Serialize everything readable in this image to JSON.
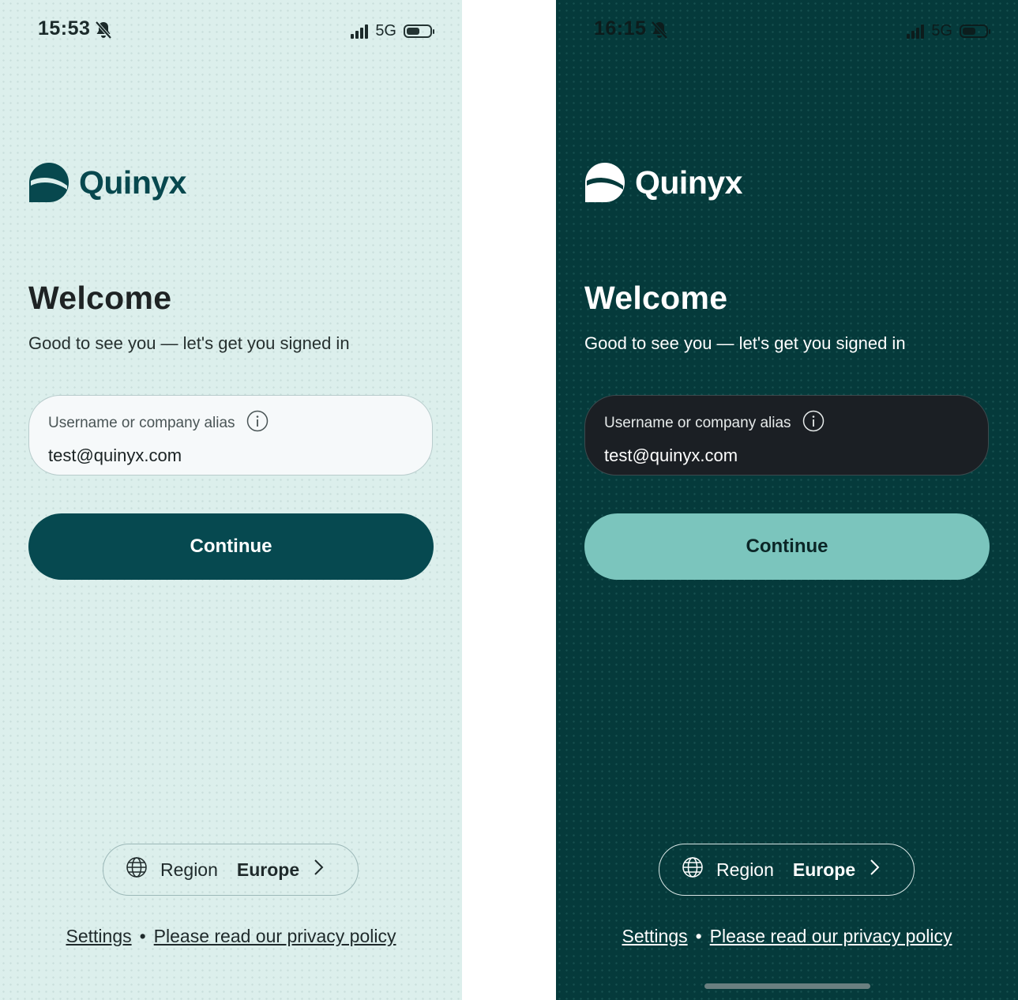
{
  "screens": [
    {
      "theme": "light",
      "status_bar": {
        "time": "15:53",
        "network": "5G"
      },
      "logo_text": "Quinyx",
      "welcome_title": "Welcome",
      "welcome_subtitle": "Good to see you — let's get you signed in",
      "field": {
        "label": "Username or company alias",
        "value": "test@quinyx.com"
      },
      "continue_label": "Continue",
      "region": {
        "label": "Region",
        "value": "Europe"
      },
      "footer": {
        "settings": "Settings",
        "separator": "•",
        "privacy": "Please read our privacy policy"
      }
    },
    {
      "theme": "dark",
      "status_bar": {
        "time": "16:15",
        "network": "5G"
      },
      "logo_text": "Quinyx",
      "welcome_title": "Welcome",
      "welcome_subtitle": "Good to see you — let's get you signed in",
      "field": {
        "label": "Username or company alias",
        "value": "test@quinyx.com"
      },
      "continue_label": "Continue",
      "region": {
        "label": "Region",
        "value": "Europe"
      },
      "footer": {
        "settings": "Settings",
        "separator": "•",
        "privacy": "Please read our privacy policy"
      }
    }
  ],
  "colors": {
    "light_background": "#dcefec",
    "light_primary": "#064950",
    "dark_background": "#053a3b",
    "dark_primary": "#7bc5bd",
    "dark_field": "#1b1f24"
  },
  "icons": [
    "bell-slash-icon",
    "cellular-signal-icon",
    "battery-icon",
    "quinyx-logo-icon",
    "info-icon",
    "globe-icon",
    "chevron-right-icon"
  ]
}
